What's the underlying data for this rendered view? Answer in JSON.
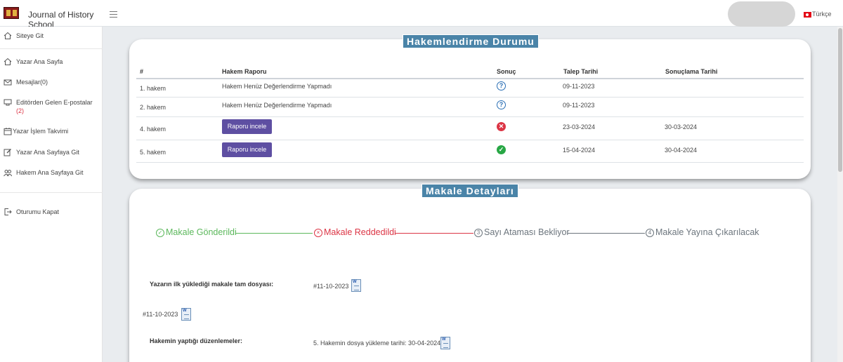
{
  "header": {
    "journal_title": "Journal of History School",
    "language": "Türkçe"
  },
  "sidebar": {
    "items": [
      {
        "label": "Siteye Git",
        "icon": "home-icon"
      },
      {
        "label": "Yazar Ana Sayfa",
        "icon": "home-icon"
      },
      {
        "label": "Mesajlar(0)",
        "icon": "envelope-icon"
      },
      {
        "label": "Editörden Gelen E-postalar",
        "badge": "(2)",
        "icon": "inbox-icon"
      },
      {
        "label": "Yazar İşlem Takvimi",
        "icon": "calendar-icon"
      },
      {
        "label": "Yazar Ana Sayfaya Git",
        "icon": "edit-icon"
      },
      {
        "label": "Hakem Ana Sayfaya Git",
        "icon": "users-icon"
      },
      {
        "label": "Oturumu Kapat",
        "icon": "logout-icon"
      }
    ]
  },
  "review_status": {
    "title": "Hakemlendirme Durumu",
    "columns": [
      "#",
      "Hakem Raporu",
      "Sonuç",
      "Talep Tarihi",
      "Sonuçlama Tarihi"
    ],
    "rows": [
      {
        "reviewer": "1. hakem",
        "report": "Hakem Henüz Değerlendirme Yapmadı",
        "result": "pending",
        "request_date": "09-11-2023",
        "result_date": ""
      },
      {
        "reviewer": "2. hakem",
        "report": "Hakem Henüz Değerlendirme Yapmadı",
        "result": "pending",
        "request_date": "09-11-2023",
        "result_date": ""
      },
      {
        "reviewer": "4. hakem",
        "report_button": "Raporu incele",
        "result": "rejected",
        "request_date": "23-03-2024",
        "result_date": "30-03-2024"
      },
      {
        "reviewer": "5. hakem",
        "report_button": "Raporu incele",
        "result": "accepted",
        "request_date": "15-04-2024",
        "result_date": "30-04-2024"
      }
    ]
  },
  "article_details": {
    "title": "Makale Detayları",
    "steps": [
      {
        "label": "Makale Gönderildi",
        "marker": "✓",
        "state": "done",
        "color": "#5cb85c"
      },
      {
        "label": "Makale Reddedildi",
        "marker": "×",
        "state": "rejected",
        "color": "#dc3545"
      },
      {
        "label": "Sayı Ataması Bekliyor",
        "marker": "3",
        "state": "todo",
        "color": "#6c757d"
      },
      {
        "label": "Makale Yayına Çıkarılacak",
        "marker": "4",
        "state": "todo",
        "color": "#6c757d"
      }
    ],
    "author_file_label": "Yazarın ilk yüklediği makale tam dosyası:",
    "author_file_value": "#11-10-2023",
    "second_file_value": "#11-10-2023",
    "reviewer_edits_label": "Hakemin yaptığı düzenlemeler:",
    "reviewer_edits_value": "5. Hakemin dosya yükleme tarihi: 30-04-2024"
  },
  "colors": {
    "accent_title": "#4a84a8",
    "button": "#5e4fa2",
    "success": "#28a745",
    "danger": "#dc3545",
    "info": "#2a6fb5"
  }
}
